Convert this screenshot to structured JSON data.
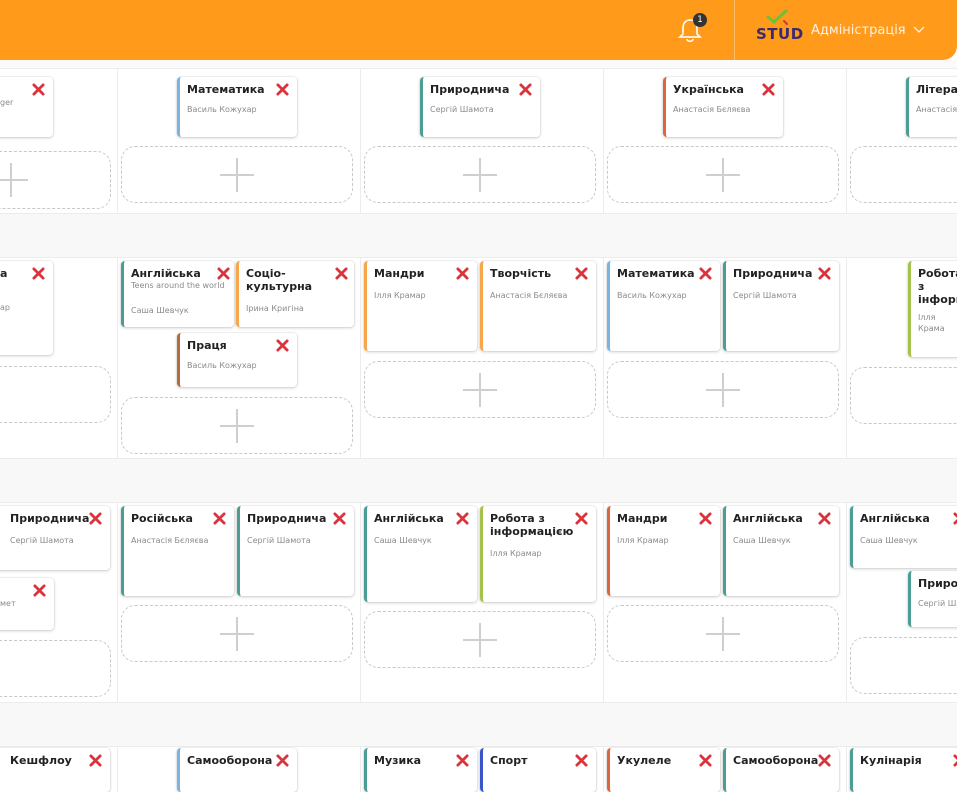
{
  "header": {
    "notifications_count": "1",
    "logo_text": "STUD",
    "user_role": "Адміністрація",
    "colors": {
      "bar": "#ff9a1a",
      "logo": "#3a2b6e",
      "check": "#6fbf3a"
    }
  },
  "icons": {
    "remove": "close-x-icon",
    "add": "plus-icon",
    "bell": "bell-icon",
    "chevron": "chevron-down-icon"
  },
  "rows": [
    {
      "cards": [
        {
          "title": "",
          "teacher": "ger"
        },
        {
          "title": "Математика",
          "teacher": "Василь Кожухар"
        },
        {
          "title": "Природнича",
          "teacher": "Сергій Шамота"
        },
        {
          "title": "Українська",
          "teacher": "Анастасія Бєляєва"
        },
        {
          "title": "Літерату",
          "teacher": "Анастасія"
        }
      ]
    },
    {
      "cards": [
        {
          "title": "а",
          "teacher": "ар"
        },
        {
          "title": "Англійська",
          "subtitle": "Teens around the world",
          "teacher": "Саша Шевчук"
        },
        {
          "title": "Соціо-культурна",
          "teacher": "Ірина Кригіна"
        },
        {
          "title": "Праця",
          "teacher": "Василь Кожухар"
        },
        {
          "title": "Мандри",
          "teacher": "Ілля Крамар"
        },
        {
          "title": "Творчість",
          "teacher": "Анастасія Бєляєва"
        },
        {
          "title": "Математика",
          "teacher": "Василь Кожухар"
        },
        {
          "title": "Природнича",
          "teacher": "Сергій Шамота"
        },
        {
          "title": "Робота з інформа",
          "teacher": "Ілля Крама"
        }
      ]
    },
    {
      "cards": [
        {
          "title": "Природнича",
          "teacher": "Сергій Шамота"
        },
        {
          "title": "",
          "teacher": "мет"
        },
        {
          "title": "Російська",
          "teacher": "Анастасія Бєляєва"
        },
        {
          "title": "Природнича",
          "teacher": "Сергій Шамота"
        },
        {
          "title": "Англійська",
          "teacher": "Саша Шевчук"
        },
        {
          "title": "Робота з інформацією",
          "teacher": "Ілля Крамар"
        },
        {
          "title": "Мандри",
          "teacher": "Ілля Крамар"
        },
        {
          "title": "Англійська",
          "teacher": "Саша Шевчук"
        },
        {
          "title": "Англійська",
          "teacher": "Саша Шевчук"
        },
        {
          "title": "Природн",
          "teacher": "Сергій Ша"
        }
      ]
    },
    {
      "cards": [
        {
          "title": "Кешфлоу"
        },
        {
          "title": "Самооборона"
        },
        {
          "title": "Музика"
        },
        {
          "title": "Спорт"
        },
        {
          "title": "Укулеле"
        },
        {
          "title": "Самооборона"
        },
        {
          "title": "Кулінарія"
        }
      ]
    }
  ]
}
